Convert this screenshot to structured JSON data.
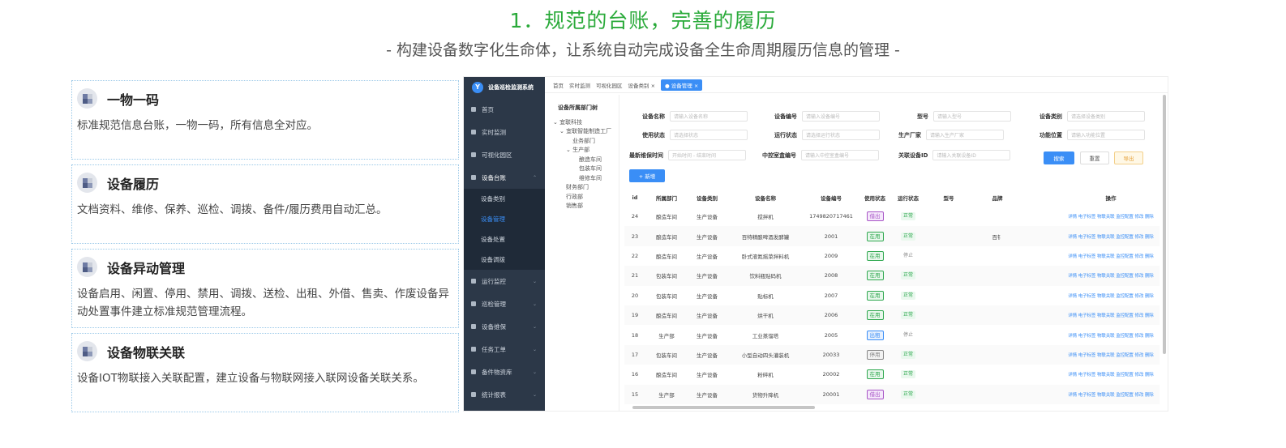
{
  "header": {
    "title": "1．规范的台账，完善的履历",
    "subtitle": "- 构建设备数字化生命体，让系统自动完成设备全生命周期履历信息的管理 -"
  },
  "cards": [
    {
      "title": "一物一码",
      "desc": "标准规范信息台账，一物一码，所有信息全对应。"
    },
    {
      "title": "设备履历",
      "desc": "文档资料、维修、保养、巡检、调拨、备件/履历费用自动汇总。"
    },
    {
      "title": "设备异动管理",
      "desc": "设备启用、闲置、停用、禁用、调拨、送检、出租、外借、售卖、作废设备异动处置事件建立标准规范管理流程。"
    },
    {
      "title": "设备物联关联",
      "desc": "设备IOT物联接入关联配置，建立设备与物联网接入联网设备关联关系。"
    }
  ],
  "app": {
    "logo": "设备巡检监测系统",
    "menu": [
      {
        "label": "首页",
        "type": "item"
      },
      {
        "label": "实时监测",
        "type": "item"
      },
      {
        "label": "可视化园区",
        "type": "item"
      },
      {
        "label": "设备台账",
        "type": "open"
      },
      {
        "label": "设备类别",
        "type": "sub"
      },
      {
        "label": "设备管理",
        "type": "subactive"
      },
      {
        "label": "设备处置",
        "type": "sub"
      },
      {
        "label": "设备调拨",
        "type": "sub"
      },
      {
        "label": "运行监控",
        "type": "group"
      },
      {
        "label": "巡检管理",
        "type": "group"
      },
      {
        "label": "设备维保",
        "type": "group"
      },
      {
        "label": "任务工单",
        "type": "group"
      },
      {
        "label": "备件物资库",
        "type": "group"
      },
      {
        "label": "统计报表",
        "type": "group"
      }
    ],
    "tabs": [
      "首页",
      "实时监测",
      "可视化园区",
      "设备类别 ×",
      "● 设备管理 ×"
    ],
    "tree_title": "设备所属部门树",
    "tree": [
      {
        "label": "⌄ 宜联科技",
        "indent": 0
      },
      {
        "label": "⌄ 宜联智能制造工厂",
        "indent": 1
      },
      {
        "label": "业务部门",
        "indent": 3
      },
      {
        "label": "⌄ 生产部",
        "indent": 2
      },
      {
        "label": "酿造车间",
        "indent": 4
      },
      {
        "label": "包装车间",
        "indent": 4
      },
      {
        "label": "维修车间",
        "indent": 4
      },
      {
        "label": "财务部门",
        "indent": 2
      },
      {
        "label": "行政部",
        "indent": 2
      },
      {
        "label": "销售部",
        "indent": 2
      }
    ],
    "filters": [
      {
        "label": "设备名称",
        "ph": "请输入设备名称"
      },
      {
        "label": "设备编号",
        "ph": "请输入设备编号"
      },
      {
        "label": "型号",
        "ph": "请输入型号"
      },
      {
        "label": "设备类别",
        "ph": "请选择设备类别"
      },
      {
        "label": "使用状态",
        "ph": "请选择状态"
      },
      {
        "label": "运行状态",
        "ph": "请选择运行状态"
      },
      {
        "label": "生产厂家",
        "ph": "请输入生产厂家"
      },
      {
        "label": "功能位置",
        "ph": "请输入功能位置"
      },
      {
        "label": "最新维保时间",
        "ph": "开始时间 - 结束时间"
      },
      {
        "label": "中控室盒编号",
        "ph": "请输入中控室盒编号"
      },
      {
        "label": "关联设备ID",
        "ph": "请输入关联设备ID"
      }
    ],
    "buttons": {
      "search": "搜索",
      "reset": "重置",
      "export": "导出",
      "add": "+ 新增"
    },
    "columns": [
      "id",
      "所属部门",
      "设备类别",
      "设备名称",
      "设备编号",
      "使用状态",
      "运行状态",
      "型号",
      "品牌",
      "操作"
    ],
    "ops": "详情 电子标签 物联关联 监控配置 修改 删除",
    "rows": [
      {
        "id": "24",
        "dept": "酿造车间",
        "cat": "生产设备",
        "name": "搅拌机",
        "code": "1749820717461",
        "use": "借出",
        "run": "正常",
        "brand": ""
      },
      {
        "id": "23",
        "dept": "酿造车间",
        "cat": "生产设备",
        "name": "百特精酿啤酒发酵罐",
        "code": "2001",
        "use": "在用",
        "run": "正常",
        "brand": "百钅"
      },
      {
        "id": "22",
        "dept": "酿造车间",
        "cat": "生产设备",
        "name": "卧式液氮摇菜拌料机",
        "code": "2009",
        "use": "在用",
        "run": "停止",
        "brand": ""
      },
      {
        "id": "21",
        "dept": "包装车间",
        "cat": "生产设备",
        "name": "饮料瓶贴码机",
        "code": "2008",
        "use": "在用",
        "run": "正常",
        "brand": ""
      },
      {
        "id": "20",
        "dept": "包装车间",
        "cat": "生产设备",
        "name": "贴标机",
        "code": "2007",
        "use": "在用",
        "run": "正常",
        "brand": ""
      },
      {
        "id": "19",
        "dept": "酿造车间",
        "cat": "生产设备",
        "name": "烘干机",
        "code": "2006",
        "use": "在用",
        "run": "正常",
        "brand": ""
      },
      {
        "id": "18",
        "dept": "生产部",
        "cat": "生产设备",
        "name": "工业蒸馏塔",
        "code": "2005",
        "use": "出租",
        "run": "停止",
        "brand": ""
      },
      {
        "id": "17",
        "dept": "包装车间",
        "cat": "生产设备",
        "name": "小型自动四头灌装机",
        "code": "20033",
        "use": "停用",
        "run": "正常",
        "brand": ""
      },
      {
        "id": "16",
        "dept": "酿造车间",
        "cat": "生产设备",
        "name": "粉碎机",
        "code": "20002",
        "use": "在用",
        "run": "正常",
        "brand": ""
      },
      {
        "id": "15",
        "dept": "生产部",
        "cat": "生产设备",
        "name": "货物升降机",
        "code": "20001",
        "use": "借出",
        "run": "正常",
        "brand": ""
      }
    ],
    "colors": {
      "accent": "#3a8ef6",
      "title_green": "#2aaa3a",
      "sidebar": "#2c3848"
    }
  }
}
